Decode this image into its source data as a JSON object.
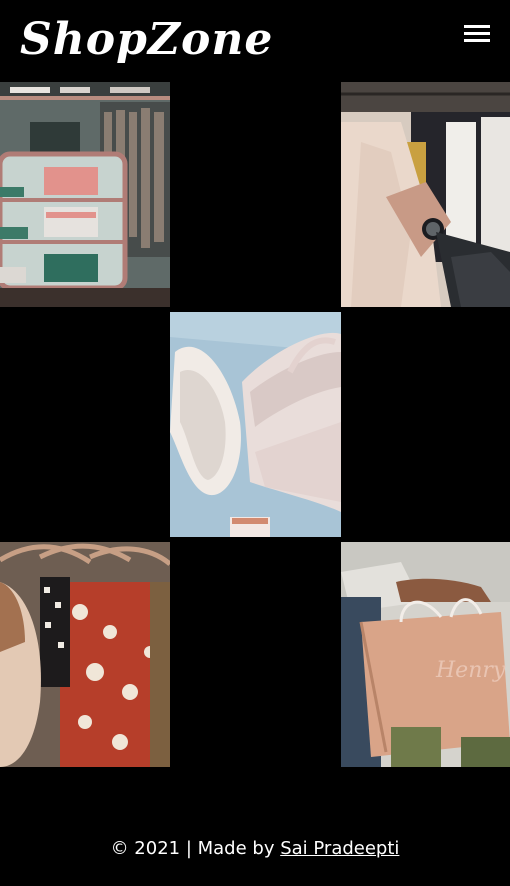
{
  "header": {
    "brand": "ShopZone",
    "menu_icon": "hamburger-menu-icon"
  },
  "gallery": {
    "images": [
      {
        "name": "store-shelves-image",
        "subject": "clothing shelves with folded shirts"
      },
      {
        "name": "hand-browsing-rack-image",
        "subject": "hand with watch browsing shirts on rack"
      },
      {
        "name": "shoes-and-handbag-image",
        "subject": "white heels and pink handbag on blue"
      },
      {
        "name": "floral-clothes-rack-image",
        "subject": "floral dresses on hangers"
      },
      {
        "name": "shopping-bags-image",
        "subject": "person holding paper shopping bags"
      }
    ]
  },
  "footer": {
    "prefix": "© 2021 | Made by ",
    "author": "Sai Pradeepti"
  }
}
